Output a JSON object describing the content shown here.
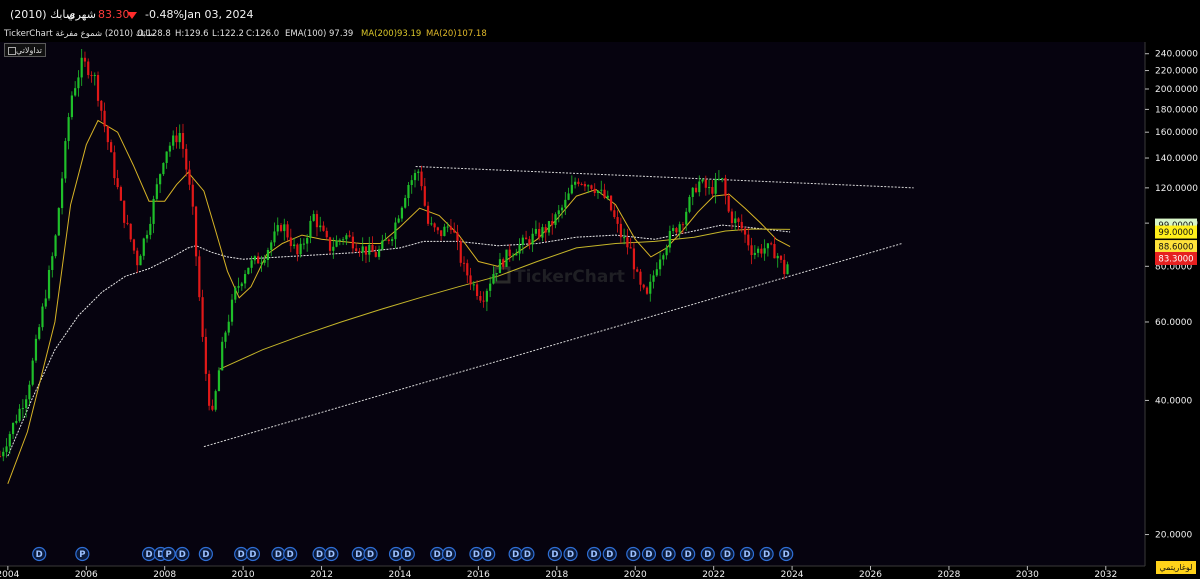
{
  "header": {
    "name": "سابك (2010)",
    "period": "شهري",
    "last_price": "83.30",
    "change_pct": "-0.48%",
    "date": "Jan 03, 2024"
  },
  "legend": {
    "source": "TickerChart سابك (2010) شموع مفرغة",
    "open": "O:128.8",
    "high": "H:129.6",
    "low": "L:122.2",
    "close": "C:126.0",
    "ema100_label": "EMA(100)",
    "ema100_value": "97.39",
    "ma200_label": "MA(200)",
    "ma200_value": "93.19",
    "ma20_label": "MA(20)",
    "ma20_value": "107.18"
  },
  "buttons": {
    "tadawulati": "تداولاتي",
    "log_scale": "لوغاريتمي"
  },
  "watermark": "TickerChart",
  "colors": {
    "background": "#06030f",
    "up": "#1fbf2a",
    "down": "#e01818",
    "ema100": "#e8e8e8",
    "ma200": "#c4b52a",
    "ma20": "#d6b326",
    "trendline": "#d8d8d8",
    "event_marker": "#2f6fd6"
  },
  "chart_data": {
    "type": "candlestick",
    "scale": "log",
    "x_ticks": [
      "2004",
      "2006",
      "2008",
      "2010",
      "2012",
      "2014",
      "2016",
      "2018",
      "2020",
      "2022",
      "2024",
      "2026",
      "2028",
      "2030",
      "2032"
    ],
    "y_ticks": [
      "240.0000",
      "220.0000",
      "200.0000",
      "180.0000",
      "160.0000",
      "140.0000",
      "120.0000",
      "100.0000",
      "80.0000",
      "60.0000",
      "40.0000",
      "20.0000"
    ],
    "y_tick_values": [
      240,
      220,
      200,
      180,
      160,
      140,
      120,
      100,
      80,
      60,
      40,
      20
    ],
    "ylim": [
      17,
      255
    ],
    "xlim": [
      2003.8,
      2033.0
    ],
    "price_labels": [
      {
        "text": "99.0000",
        "value": 99,
        "color": "#d9f7c8"
      },
      {
        "text": "99.0000",
        "value": 95.5,
        "color": "#ffef1a"
      },
      {
        "text": "88.6000",
        "value": 88.6,
        "color": "#ffe23a"
      },
      {
        "text": "83.3000",
        "value": 83.3,
        "color": "#e62020"
      }
    ],
    "anchors": [
      [
        2003.8,
        30
      ],
      [
        2004.5,
        42
      ],
      [
        2005.2,
        90
      ],
      [
        2005.6,
        190
      ],
      [
        2005.9,
        230
      ],
      [
        2006.2,
        215
      ],
      [
        2006.5,
        160
      ],
      [
        2006.9,
        108
      ],
      [
        2007.3,
        82
      ],
      [
        2007.6,
        100
      ],
      [
        2008.0,
        145
      ],
      [
        2008.4,
        160
      ],
      [
        2008.7,
        110
      ],
      [
        2009.0,
        50
      ],
      [
        2009.2,
        36
      ],
      [
        2009.5,
        55
      ],
      [
        2009.8,
        70
      ],
      [
        2010.1,
        80
      ],
      [
        2010.5,
        84
      ],
      [
        2011.0,
        100
      ],
      [
        2011.4,
        84
      ],
      [
        2011.8,
        104
      ],
      [
        2012.2,
        88
      ],
      [
        2012.6,
        94
      ],
      [
        2013.0,
        88
      ],
      [
        2013.4,
        85
      ],
      [
        2013.8,
        95
      ],
      [
        2014.2,
        122
      ],
      [
        2014.5,
        132
      ],
      [
        2014.7,
        100
      ],
      [
        2015.0,
        94
      ],
      [
        2015.3,
        100
      ],
      [
        2015.6,
        80
      ],
      [
        2015.9,
        72
      ],
      [
        2016.1,
        68
      ],
      [
        2016.4,
        78
      ],
      [
        2016.8,
        86
      ],
      [
        2017.3,
        92
      ],
      [
        2017.8,
        98
      ],
      [
        2018.2,
        110
      ],
      [
        2018.5,
        126
      ],
      [
        2018.9,
        122
      ],
      [
        2019.3,
        112
      ],
      [
        2019.6,
        95
      ],
      [
        2019.9,
        86
      ],
      [
        2020.1,
        72
      ],
      [
        2020.3,
        68
      ],
      [
        2020.6,
        84
      ],
      [
        2020.9,
        94
      ],
      [
        2021.2,
        102
      ],
      [
        2021.6,
        124
      ],
      [
        2021.9,
        118
      ],
      [
        2022.2,
        126
      ],
      [
        2022.4,
        104
      ],
      [
        2022.7,
        98
      ],
      [
        2023.0,
        86
      ],
      [
        2023.3,
        88
      ],
      [
        2023.6,
        86
      ],
      [
        2023.8,
        78
      ],
      [
        2023.95,
        83.3
      ]
    ],
    "ema100": [
      [
        2004.0,
        30
      ],
      [
        2004.6,
        40
      ],
      [
        2005.2,
        52
      ],
      [
        2005.8,
        62
      ],
      [
        2006.4,
        70
      ],
      [
        2007.0,
        76
      ],
      [
        2007.6,
        79
      ],
      [
        2008.2,
        84
      ],
      [
        2008.6,
        88
      ],
      [
        2008.8,
        89
      ],
      [
        2009.2,
        86
      ],
      [
        2009.6,
        84
      ],
      [
        2010.0,
        83
      ],
      [
        2011.0,
        84
      ],
      [
        2012.0,
        85
      ],
      [
        2013.0,
        86
      ],
      [
        2014.0,
        88
      ],
      [
        2014.6,
        91
      ],
      [
        2015.5,
        91
      ],
      [
        2016.5,
        89
      ],
      [
        2017.5,
        90
      ],
      [
        2018.5,
        93
      ],
      [
        2019.5,
        94
      ],
      [
        2020.5,
        92
      ],
      [
        2021.5,
        96
      ],
      [
        2022.2,
        99
      ],
      [
        2022.8,
        98
      ],
      [
        2023.5,
        96.5
      ],
      [
        2023.95,
        95.5
      ]
    ],
    "ma200": [
      [
        2009.4,
        47
      ],
      [
        2010.5,
        52
      ],
      [
        2011.5,
        56
      ],
      [
        2012.5,
        60
      ],
      [
        2013.5,
        64
      ],
      [
        2014.5,
        68
      ],
      [
        2015.5,
        72
      ],
      [
        2016.5,
        76
      ],
      [
        2017.5,
        82
      ],
      [
        2018.5,
        88
      ],
      [
        2019.5,
        90
      ],
      [
        2020.5,
        91
      ],
      [
        2021.5,
        93
      ],
      [
        2022.3,
        96
      ],
      [
        2023.0,
        97
      ],
      [
        2023.95,
        96.8
      ]
    ],
    "ma20": [
      [
        2004.0,
        26
      ],
      [
        2004.5,
        34
      ],
      [
        2005.2,
        60
      ],
      [
        2005.6,
        110
      ],
      [
        2006.0,
        150
      ],
      [
        2006.3,
        170
      ],
      [
        2006.8,
        160
      ],
      [
        2007.2,
        135
      ],
      [
        2007.6,
        112
      ],
      [
        2008.0,
        112
      ],
      [
        2008.3,
        122
      ],
      [
        2008.6,
        130
      ],
      [
        2009.0,
        118
      ],
      [
        2009.3,
        96
      ],
      [
        2009.6,
        78
      ],
      [
        2009.9,
        68
      ],
      [
        2010.2,
        72
      ],
      [
        2010.6,
        85
      ],
      [
        2011.0,
        90
      ],
      [
        2011.5,
        94
      ],
      [
        2012.0,
        92
      ],
      [
        2012.5,
        91
      ],
      [
        2013.0,
        90
      ],
      [
        2013.5,
        90
      ],
      [
        2014.0,
        98
      ],
      [
        2014.5,
        108
      ],
      [
        2015.0,
        104
      ],
      [
        2015.5,
        94
      ],
      [
        2016.0,
        82
      ],
      [
        2016.5,
        80
      ],
      [
        2017.0,
        86
      ],
      [
        2017.5,
        92
      ],
      [
        2018.0,
        102
      ],
      [
        2018.5,
        115
      ],
      [
        2019.0,
        119
      ],
      [
        2019.5,
        110
      ],
      [
        2020.0,
        92
      ],
      [
        2020.4,
        84
      ],
      [
        2020.8,
        88
      ],
      [
        2021.2,
        96
      ],
      [
        2021.6,
        106
      ],
      [
        2022.0,
        115
      ],
      [
        2022.4,
        116
      ],
      [
        2022.8,
        108
      ],
      [
        2023.2,
        100
      ],
      [
        2023.6,
        92
      ],
      [
        2023.95,
        88.6
      ]
    ],
    "trendlines": [
      {
        "from": [
          2014.4,
          134
        ],
        "to": [
          2027.1,
          120
        ]
      },
      {
        "from": [
          2009.0,
          31.5
        ],
        "to": [
          2026.8,
          90
        ]
      }
    ],
    "event_markers": [
      {
        "year": 2004.8,
        "label": "D"
      },
      {
        "year": 2005.9,
        "label": "P"
      },
      {
        "year": 2007.6,
        "label": "D"
      },
      {
        "year": 2007.9,
        "label": "D"
      },
      {
        "year": 2008.1,
        "label": "P"
      },
      {
        "year": 2008.45,
        "label": "D"
      },
      {
        "year": 2009.05,
        "label": "D"
      },
      {
        "year": 2009.95,
        "label": "D"
      },
      {
        "year": 2010.25,
        "label": "D"
      },
      {
        "year": 2010.9,
        "label": "D"
      },
      {
        "year": 2011.2,
        "label": "D"
      },
      {
        "year": 2011.95,
        "label": "D"
      },
      {
        "year": 2012.25,
        "label": "D"
      },
      {
        "year": 2012.95,
        "label": "D"
      },
      {
        "year": 2013.25,
        "label": "D"
      },
      {
        "year": 2013.9,
        "label": "D"
      },
      {
        "year": 2014.2,
        "label": "D"
      },
      {
        "year": 2014.95,
        "label": "D"
      },
      {
        "year": 2015.25,
        "label": "D"
      },
      {
        "year": 2015.95,
        "label": "D"
      },
      {
        "year": 2016.25,
        "label": "D"
      },
      {
        "year": 2016.95,
        "label": "D"
      },
      {
        "year": 2017.25,
        "label": "D"
      },
      {
        "year": 2017.95,
        "label": "D"
      },
      {
        "year": 2018.35,
        "label": "D"
      },
      {
        "year": 2018.95,
        "label": "D"
      },
      {
        "year": 2019.35,
        "label": "D"
      },
      {
        "year": 2019.95,
        "label": "D"
      },
      {
        "year": 2020.35,
        "label": "D"
      },
      {
        "year": 2020.85,
        "label": "D"
      },
      {
        "year": 2021.35,
        "label": "D"
      },
      {
        "year": 2021.85,
        "label": "D"
      },
      {
        "year": 2022.35,
        "label": "D"
      },
      {
        "year": 2022.85,
        "label": "D"
      },
      {
        "year": 2023.35,
        "label": "D"
      },
      {
        "year": 2023.85,
        "label": "D"
      }
    ]
  }
}
